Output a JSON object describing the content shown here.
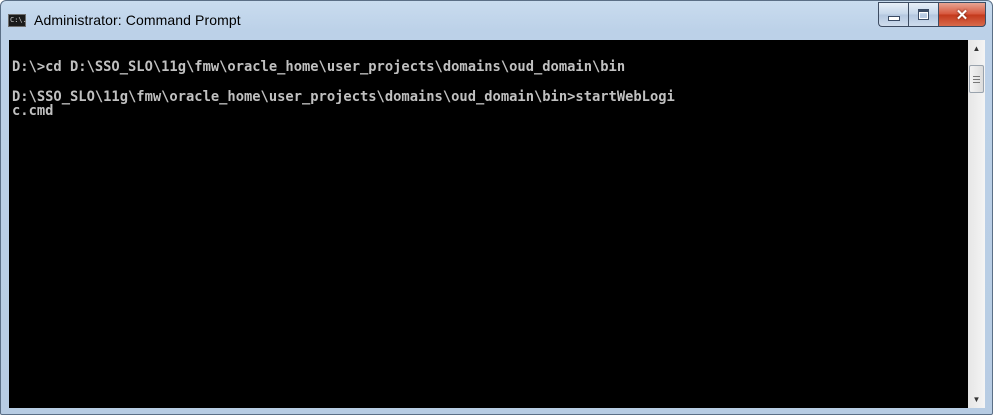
{
  "window": {
    "title": "Administrator: Command Prompt",
    "icon": "cmd-icon",
    "icon_text": "C:\\.",
    "buttons": {
      "minimize": "minimize-icon",
      "maximize": "maximize-icon",
      "close": "✕"
    }
  },
  "console": {
    "lines": [
      "D:\\>cd D:\\SSO_SLO\\11g\\fmw\\oracle_home\\user_projects\\domains\\oud_domain\\bin",
      "",
      "D:\\SSO_SLO\\11g\\fmw\\oracle_home\\user_projects\\domains\\oud_domain\\bin>startWebLogi",
      "c.cmd"
    ]
  },
  "scrollbar": {
    "up_arrow": "▲",
    "down_arrow": "▼"
  },
  "colors": {
    "console_bg": "#000000",
    "console_text": "#c0c0c0",
    "close_button": "#c7432a"
  }
}
